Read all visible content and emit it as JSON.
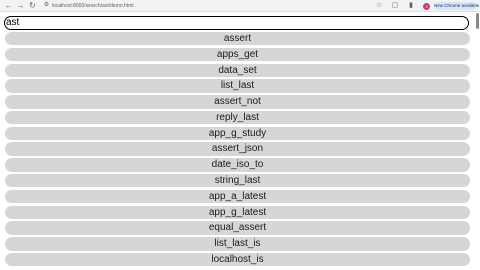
{
  "browser": {
    "address": "localhost:8000/search/ast/demo.html",
    "update_label": "New Chrome available",
    "avatar_letter": "J"
  },
  "search": {
    "value": "ast"
  },
  "results": [
    "assert",
    "apps_get",
    "data_set",
    "list_last",
    "assert_not",
    "reply_last",
    "app_g_study",
    "assert_json",
    "date_iso_to",
    "string_last",
    "app_a_latest",
    "app_g_latest",
    "equal_assert",
    "list_last_is",
    "localhost_is"
  ]
}
